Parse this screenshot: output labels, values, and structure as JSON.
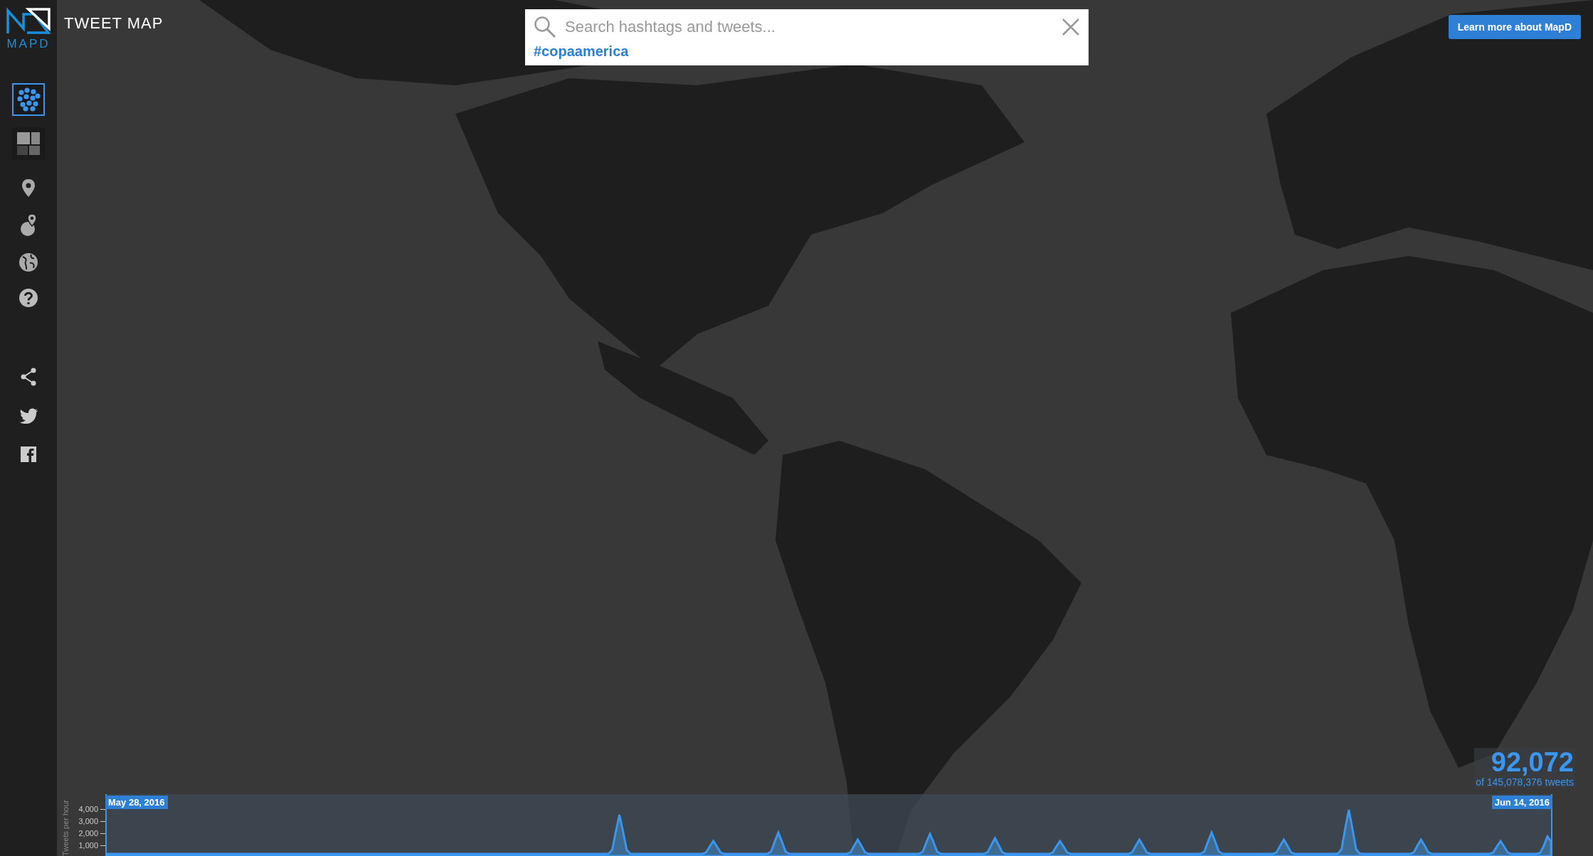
{
  "app": {
    "logo_text": "MAPD",
    "title": "TWEET MAP"
  },
  "sidebar": {
    "views": [
      {
        "kind": "points",
        "selected": true
      },
      {
        "kind": "heatmap",
        "selected": false
      }
    ],
    "tools": [
      {
        "kind": "pin"
      },
      {
        "kind": "pin-area"
      },
      {
        "kind": "globe"
      },
      {
        "kind": "help"
      }
    ],
    "social": [
      {
        "kind": "share"
      },
      {
        "kind": "twitter"
      },
      {
        "kind": "facebook"
      }
    ]
  },
  "search": {
    "placeholder": "Search hashtags and tweets...",
    "tag": "#copaamerica"
  },
  "learn_more_button": "Learn more about MapD",
  "counter": {
    "count": "92,072",
    "total": "of 145,078,376 tweets"
  },
  "timeline": {
    "y_label": "Tweets per hour",
    "yticks": [
      "4,000",
      "3,000",
      "2,000",
      "1,000"
    ],
    "start_date": "May 28, 2016",
    "end_date": "Jun 14, 2016"
  }
}
